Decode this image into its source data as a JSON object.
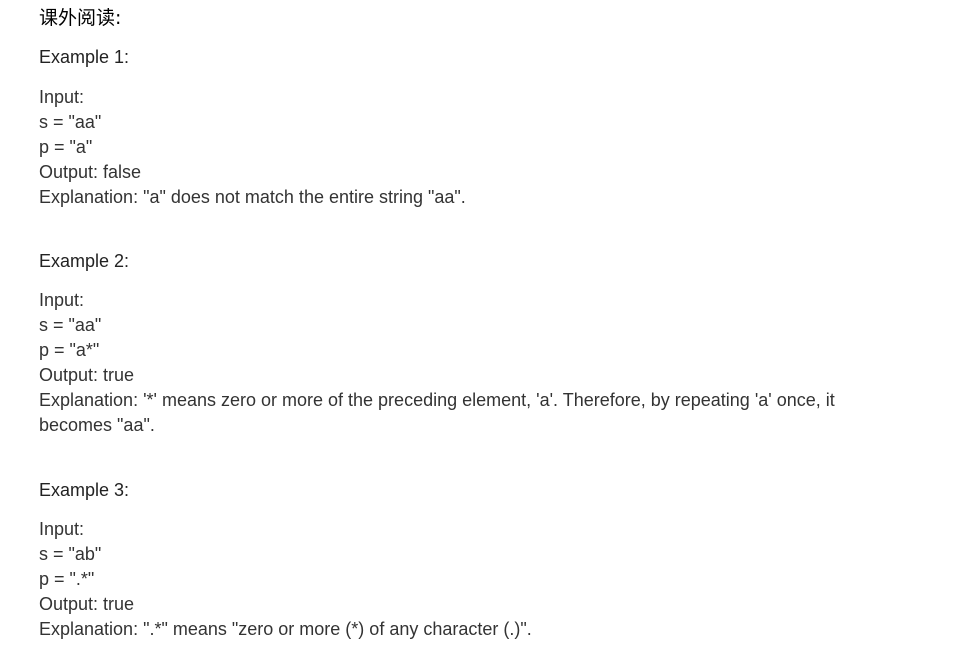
{
  "heading": "课外阅读:",
  "examples": [
    {
      "title": "Example 1:",
      "input_label": "Input:",
      "s_line": "s = \"aa\"",
      "p_line": "p = \"a\"",
      "output_line": "Output: false",
      "explanation_line": "Explanation: \"a\" does not match the entire string \"aa\"."
    },
    {
      "title": "Example 2:",
      "input_label": "Input:",
      "s_line": "s = \"aa\"",
      "p_line": "p = \"a*\"",
      "output_line": "Output: true",
      "explanation_line": "Explanation: '*' means zero or more of the preceding element, 'a'. Therefore, by repeating 'a' once, it becomes \"aa\"."
    },
    {
      "title": "Example 3:",
      "input_label": "Input:",
      "s_line": "s = \"ab\"",
      "p_line": "p = \".*\"",
      "output_line": "Output: true",
      "explanation_line": "Explanation: \".*\" means \"zero or more (*) of any character (.)\"."
    }
  ]
}
